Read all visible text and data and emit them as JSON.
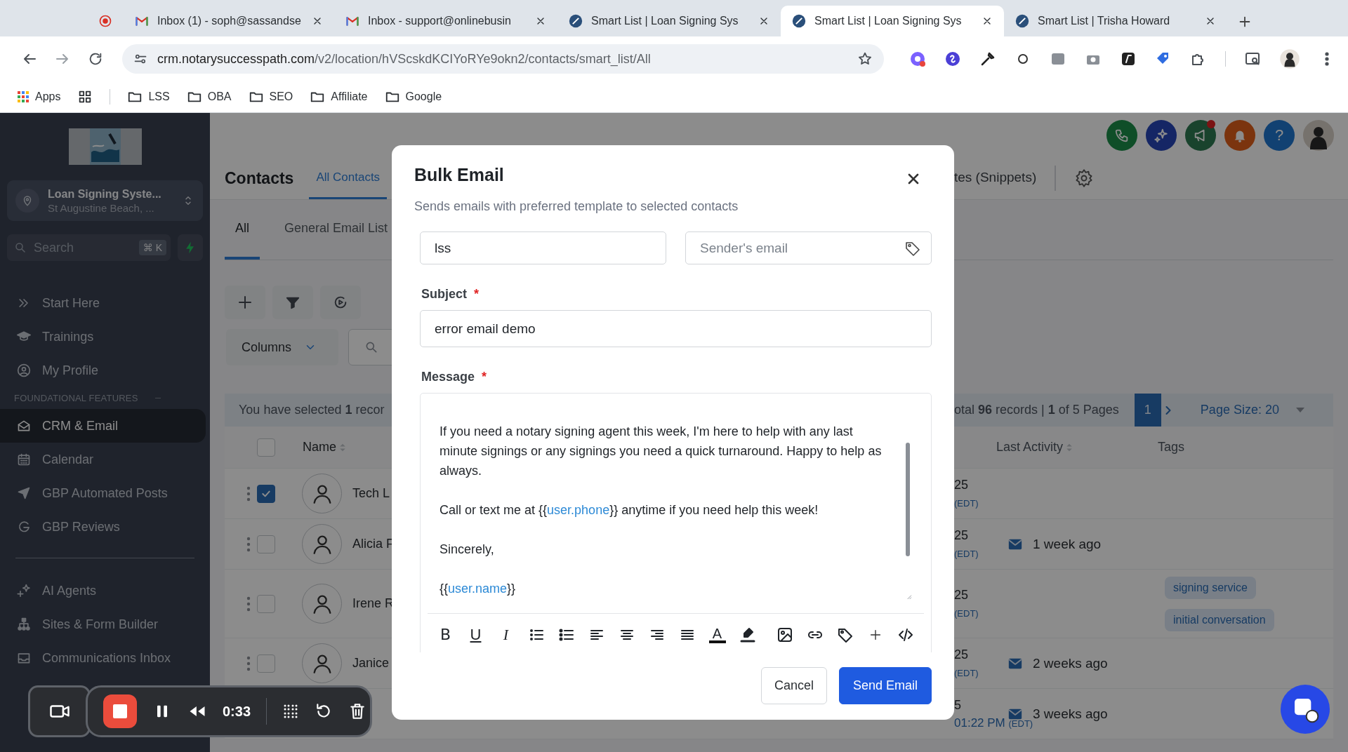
{
  "browser": {
    "tabs": [
      {
        "kind": "recording",
        "selected": false
      },
      {
        "kind": "mail",
        "title": "Inbox (1) - soph@sassandse",
        "selected": false
      },
      {
        "kind": "mail",
        "title": "Inbox - support@onlinebusin",
        "selected": false
      },
      {
        "kind": "site",
        "title": "Smart List | Loan Signing Sys",
        "selected": false
      },
      {
        "kind": "site",
        "title": "Smart List | Loan Signing Sys",
        "selected": true
      },
      {
        "kind": "site",
        "title": "Smart List | Trisha Howard",
        "selected": false
      }
    ],
    "url": {
      "host": "crm.notarysuccesspath.com",
      "path": "/v2/location/hVScskdKCIYoRYe9okn2/contacts/smart_list/All"
    },
    "bookmarks": [
      {
        "kind": "apps",
        "label": "Apps"
      },
      {
        "kind": "grid"
      },
      {
        "kind": "folder",
        "label": "LSS"
      },
      {
        "kind": "folder",
        "label": "OBA"
      },
      {
        "kind": "folder",
        "label": "SEO"
      },
      {
        "kind": "folder",
        "label": "Affiliate"
      },
      {
        "kind": "folder",
        "label": "Google"
      }
    ]
  },
  "sidebar": {
    "account": {
      "name": "Loan Signing Syste...",
      "location": "St Augustine Beach, ..."
    },
    "search": {
      "placeholder": "Search",
      "shortcut": "⌘ K"
    },
    "groups": [
      {
        "items": [
          {
            "label": "Start Here",
            "selected": false
          },
          {
            "label": "Trainings",
            "selected": false
          },
          {
            "label": "My Profile",
            "selected": false
          }
        ]
      },
      {
        "heading": "FOUNDATIONAL FEATURES",
        "items": [
          {
            "label": "CRM & Email",
            "selected": true
          },
          {
            "label": "Calendar",
            "selected": false
          },
          {
            "label": "GBP Automated Posts",
            "selected": false
          },
          {
            "label": "GBP Reviews",
            "selected": false
          }
        ]
      },
      {
        "items": [
          {
            "label": "AI Agents",
            "selected": false
          },
          {
            "label": "Sites & Form Builder",
            "selected": false
          },
          {
            "label": "Communications Inbox",
            "selected": false
          }
        ]
      }
    ]
  },
  "contacts": {
    "header_actions": [
      {
        "kind": "phone",
        "unread": false
      },
      {
        "kind": "assistant",
        "unread": false
      },
      {
        "kind": "announce",
        "unread": true
      },
      {
        "kind": "bell",
        "unread": false
      },
      {
        "kind": "help",
        "label": "?",
        "unread": false
      },
      {
        "kind": "avatar",
        "unread": false
      }
    ],
    "title": "Contacts",
    "tabs": [
      {
        "label": "All Contacts",
        "selected": true
      },
      {
        "label": "tes (Snippets)",
        "selected": false
      }
    ],
    "lists": [
      {
        "label": "All",
        "selected": true
      },
      {
        "label": "General Email List",
        "selected": false
      }
    ],
    "columns_button": "Columns",
    "selection_note": "You have selected **1** recor",
    "totals": "otal **96** records | **1** of 5 Pages",
    "pages": [
      {
        "label": "1",
        "selected": true
      }
    ],
    "page_size": "Page Size: 20",
    "table": {
      "all_checked": false,
      "columns": [
        {
          "label": "Name",
          "sortable": true
        },
        {
          "label": "Last Activity",
          "sortable": true
        },
        {
          "label": "Tags",
          "sortable": false
        }
      ],
      "rows": [
        {
          "checked": true,
          "name": "Tech L",
          "date": "25",
          "zone": "(EDT)"
        },
        {
          "checked": false,
          "name": "Alicia F",
          "date": "25",
          "zone": "(EDT)",
          "last_activity": "1 week ago"
        },
        {
          "checked": false,
          "name": "Irene R",
          "date": "25",
          "zone": "(EDT)",
          "tags": [
            "signing service",
            "initial conversation"
          ]
        },
        {
          "checked": false,
          "name": "Janice",
          "date": "25",
          "zone": "(EDT)",
          "last_activity": "2 weeks ago"
        },
        {
          "date": "5",
          "time": "01:22 PM",
          "zone": "(EDT)",
          "last_activity": "3 weeks ago"
        }
      ]
    }
  },
  "modal": {
    "title": "Bulk Email",
    "subtitle": "Sends emails with preferred template to selected contacts",
    "from_name": {
      "value": "lss"
    },
    "from_email": {
      "placeholder": "Sender's email"
    },
    "subject": {
      "label": "Subject",
      "required_mark": "*",
      "value": "error email demo"
    },
    "message": {
      "label": "Message",
      "required_mark": "*",
      "paragraphs": [
        [
          {
            "kind": "text",
            "text": "If you need a notary signing agent this week, I'm here to help with any last minute signings or any signings you need a quick turnaround. Happy to help as always."
          }
        ],
        [
          {
            "kind": "text",
            "text": "Call or text me at {{"
          },
          {
            "kind": "variable",
            "text": "user.phone"
          },
          {
            "kind": "text",
            "text": "}} anytime if you need help this week!"
          }
        ],
        [
          {
            "kind": "text",
            "text": "Sincerely,"
          }
        ],
        [
          {
            "kind": "text",
            "text": "{{"
          },
          {
            "kind": "variable",
            "text": "user.name"
          },
          {
            "kind": "text",
            "text": "}}"
          }
        ]
      ]
    },
    "toolbar": [
      {
        "kind": "bold",
        "label": "B"
      },
      {
        "kind": "underline",
        "label": "U"
      },
      {
        "kind": "italic",
        "label": "I"
      },
      {
        "kind": "ordered-list"
      },
      {
        "kind": "bullet-list"
      },
      {
        "kind": "align-left"
      },
      {
        "kind": "align-center"
      },
      {
        "kind": "align-right"
      },
      {
        "kind": "justify"
      },
      {
        "kind": "text-color",
        "label": "A"
      },
      {
        "kind": "highlight"
      },
      {
        "kind": "image"
      },
      {
        "kind": "link"
      },
      {
        "kind": "tag"
      },
      {
        "kind": "plus"
      },
      {
        "kind": "code"
      }
    ],
    "buttons": [
      {
        "kind": "secondary",
        "label": "Cancel"
      },
      {
        "kind": "primary",
        "label": "Send Email"
      }
    ]
  },
  "recorder": {
    "time": "0:33"
  }
}
